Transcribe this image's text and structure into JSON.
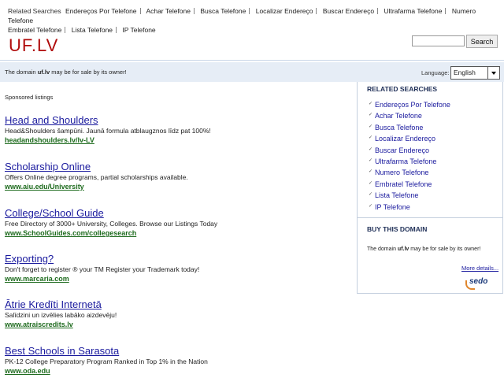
{
  "related_searches_label": "Related Searches",
  "top_links": [
    "Endereços Por Telefone",
    "Achar Telefone",
    "Busca Telefone",
    "Localizar Endereço",
    "Buscar Endereço",
    "Ultrafarma Telefone",
    "Numero Telefone",
    "Embratel Telefone",
    "Lista Telefone",
    "IP Telefone"
  ],
  "logo": "UF.LV",
  "search": {
    "value": "",
    "button": "Search"
  },
  "infobar": {
    "msg_pre": "The domain ",
    "domain": "uf.lv",
    "msg_post": " may be for sale by its owner!",
    "lang_label": "Language:",
    "lang_value": "English"
  },
  "sponsored_label": "Sponsored listings",
  "ads": [
    {
      "title": "Head and Shoulders",
      "desc": "Head&Shoulders šampūni. Jaunā formula atblaugznos līdz pat 100%!",
      "url": "headandshoulders.lv/lv-LV"
    },
    {
      "title": "Scholarship Online",
      "desc": "Offers Online degree programs, partial scholarships available.",
      "url": "www.aiu.edu/University"
    },
    {
      "title": "College/School Guide",
      "desc": "Free Directory of 3000+ University, Colleges. Browse our Listings Today",
      "url": "www.SchoolGuides.com/collegesearch"
    },
    {
      "title": "Exporting?",
      "desc": "Don't forget to register ® your TM Register your Trademark today!",
      "url": "www.marcaria.com"
    },
    {
      "title": "Ātrie Kredīti Internetā",
      "desc": "Salīdzini un izvēlies labāko aizdevēju!",
      "url": "www.atraiscredits.lv"
    },
    {
      "title": "Best Schools in Sarasota",
      "desc": "PK-12 College Preparatory Program Ranked in Top 1% in the Nation",
      "url": "www.oda.edu"
    }
  ],
  "sidebar": {
    "related_title": "RELATED SEARCHES",
    "related": [
      "Endereços Por Telefone",
      "Achar Telefone",
      "Busca Telefone",
      "Localizar Endereço",
      "Buscar Endereço",
      "Ultrafarma Telefone",
      "Numero Telefone",
      "Embratel Telefone",
      "Lista Telefone",
      "IP Telefone"
    ],
    "buy_title": "BUY THIS DOMAIN",
    "buy_pre": "The domain ",
    "buy_domain": "uf.lv",
    "buy_post": " may be for sale by its owner!",
    "more": "More details...",
    "brand": "sedo"
  }
}
